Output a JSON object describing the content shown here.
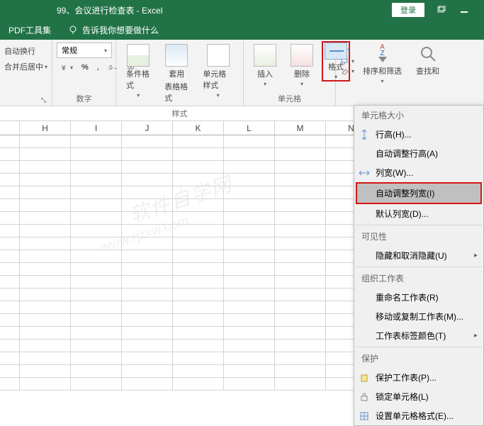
{
  "title_bar": {
    "doc_name": "99、会议进行检查表 - Excel",
    "login": "登录"
  },
  "secondary_bar": {
    "pdf_tool": "PDF工具集",
    "tell_me": "告诉我你想要做什么"
  },
  "ribbon": {
    "align": {
      "wrap": "自动换行",
      "merge": "合并后居中",
      "group_label": ""
    },
    "number": {
      "format": "常规",
      "currency": "%",
      "percent": "%",
      "comma": ",",
      "inc": ".0",
      "dec": ".00",
      "group_label": "数字"
    },
    "styles": {
      "cond_format": "条件格式",
      "table_format_1": "套用",
      "table_format_2": "表格格式",
      "cell_style": "单元格样式",
      "group_label": "样式"
    },
    "cells": {
      "insert": "插入",
      "delete": "删除",
      "format": "格式",
      "group_label": "单元格"
    },
    "editing": {
      "sort_filter": "排序和筛选",
      "find": "查找和",
      "group_label": ""
    }
  },
  "columns": [
    "H",
    "I",
    "J",
    "K",
    "L",
    "M",
    "N"
  ],
  "format_menu": {
    "section_cell_size": "单元格大小",
    "row_height": "行高(H)...",
    "autofit_row": "自动调整行高(A)",
    "col_width": "列宽(W)...",
    "autofit_col": "自动调整列宽(I)",
    "default_width": "默认列宽(D)...",
    "section_visibility": "可见性",
    "hide_unhide": "隐藏和取消隐藏(U)",
    "section_organize": "组织工作表",
    "rename": "重命名工作表(R)",
    "move_copy": "移动或复制工作表(M)...",
    "tab_color": "工作表标签颜色(T)",
    "section_protection": "保护",
    "protect_sheet": "保护工作表(P)...",
    "lock_cell": "锁定单元格(L)",
    "format_cells": "设置单元格格式(E)..."
  },
  "watermark": {
    "main": "软件自学网",
    "url": "www.rjzxw.com"
  }
}
